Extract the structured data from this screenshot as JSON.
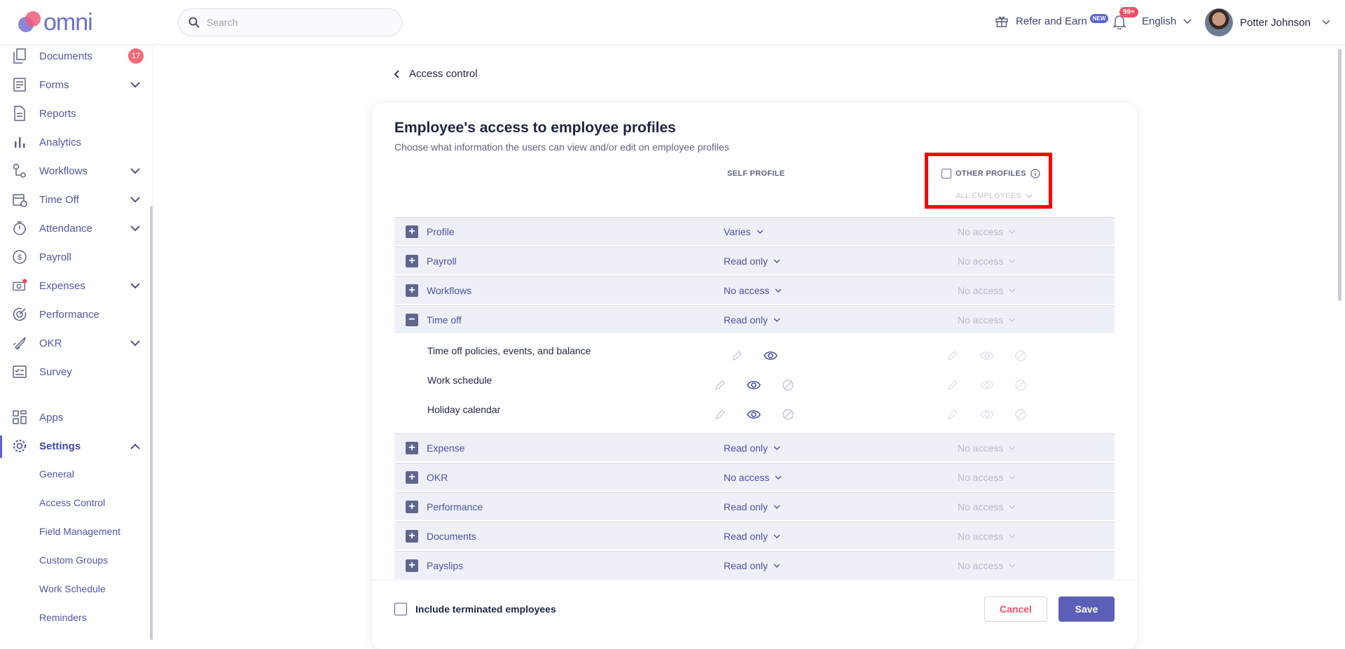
{
  "header": {
    "brand": "omni",
    "search_placeholder": "Search",
    "refer_label": "Refer and Earn",
    "refer_badge": "NEW",
    "notifications_count": "99+",
    "language": "English",
    "user_name": "Potter Johnson"
  },
  "sidebar": {
    "items": [
      {
        "label": "Documents",
        "icon": "documents-icon",
        "count": "17"
      },
      {
        "label": "Forms",
        "icon": "forms-icon"
      },
      {
        "label": "Reports",
        "icon": "reports-icon"
      },
      {
        "label": "Analytics",
        "icon": "analytics-icon"
      },
      {
        "label": "Workflows",
        "icon": "workflows-icon"
      },
      {
        "label": "Time Off",
        "icon": "time-off-icon"
      },
      {
        "label": "Attendance",
        "icon": "attendance-icon"
      },
      {
        "label": "Payroll",
        "icon": "payroll-icon"
      },
      {
        "label": "Expenses",
        "icon": "expenses-icon"
      },
      {
        "label": "Performance",
        "icon": "performance-icon"
      },
      {
        "label": "OKR",
        "icon": "okr-icon"
      },
      {
        "label": "Survey",
        "icon": "survey-icon"
      },
      {
        "label": "Apps",
        "icon": "apps-icon"
      },
      {
        "label": "Settings",
        "icon": "settings-icon"
      }
    ],
    "settings_sub": [
      "General",
      "Access Control",
      "Field Management",
      "Custom Groups",
      "Work Schedule",
      "Reminders"
    ]
  },
  "page": {
    "back_label": "Access control",
    "title": "Employee's access to employee profiles",
    "subtitle": "Choose what information the users can view and/or edit on employee profiles",
    "col_self": "SELF PROFILE",
    "col_other": "OTHER PROFILES",
    "other_scope": "ALL EMPLOYEES",
    "rows": [
      {
        "name": "Profile",
        "self": "Varies",
        "other": "No access",
        "expanded": false
      },
      {
        "name": "Payroll",
        "self": "Read only",
        "other": "No access",
        "expanded": false
      },
      {
        "name": "Workflows",
        "self": "No access",
        "other": "No access",
        "expanded": false
      },
      {
        "name": "Time off",
        "self": "Read only",
        "other": "No access",
        "expanded": true
      },
      {
        "name": "Expense",
        "self": "Read only",
        "other": "No access",
        "expanded": false
      },
      {
        "name": "OKR",
        "self": "No access",
        "other": "No access",
        "expanded": false
      },
      {
        "name": "Performance",
        "self": "Read only",
        "other": "No access",
        "expanded": false
      },
      {
        "name": "Documents",
        "self": "Read only",
        "other": "No access",
        "expanded": false
      },
      {
        "name": "Payslips",
        "self": "Read only",
        "other": "No access",
        "expanded": false
      }
    ],
    "time_off_sub": [
      "Time off policies, events, and balance",
      "Work schedule",
      "Holiday calendar"
    ],
    "include_terminated": "Include terminated employees",
    "cancel_label": "Cancel",
    "save_label": "Save"
  },
  "colors": {
    "accent": "#5b5fb8",
    "highlight": "#ff0000",
    "badge": "#ef4f68"
  }
}
